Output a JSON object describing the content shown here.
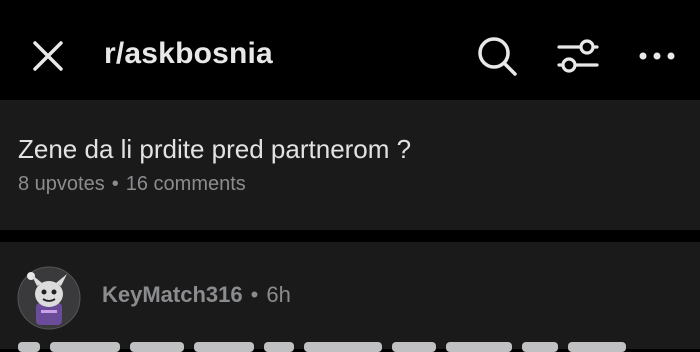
{
  "header": {
    "subreddit": "r/askbosnia",
    "icons": [
      "close-icon",
      "search-icon",
      "filter-icon",
      "more-icon"
    ]
  },
  "post": {
    "title": "Zene da li prdite pred partnerom ?",
    "upvotes": "8 upvotes",
    "separator": "•",
    "comments": "16 comments"
  },
  "comment": {
    "author": "KeyMatch316",
    "separator": "•",
    "age": "6h"
  },
  "colors": {
    "background": "#000000",
    "card": "#1a1a1b",
    "text_primary": "#e2e2e2",
    "text_secondary": "#8a8c8e"
  }
}
